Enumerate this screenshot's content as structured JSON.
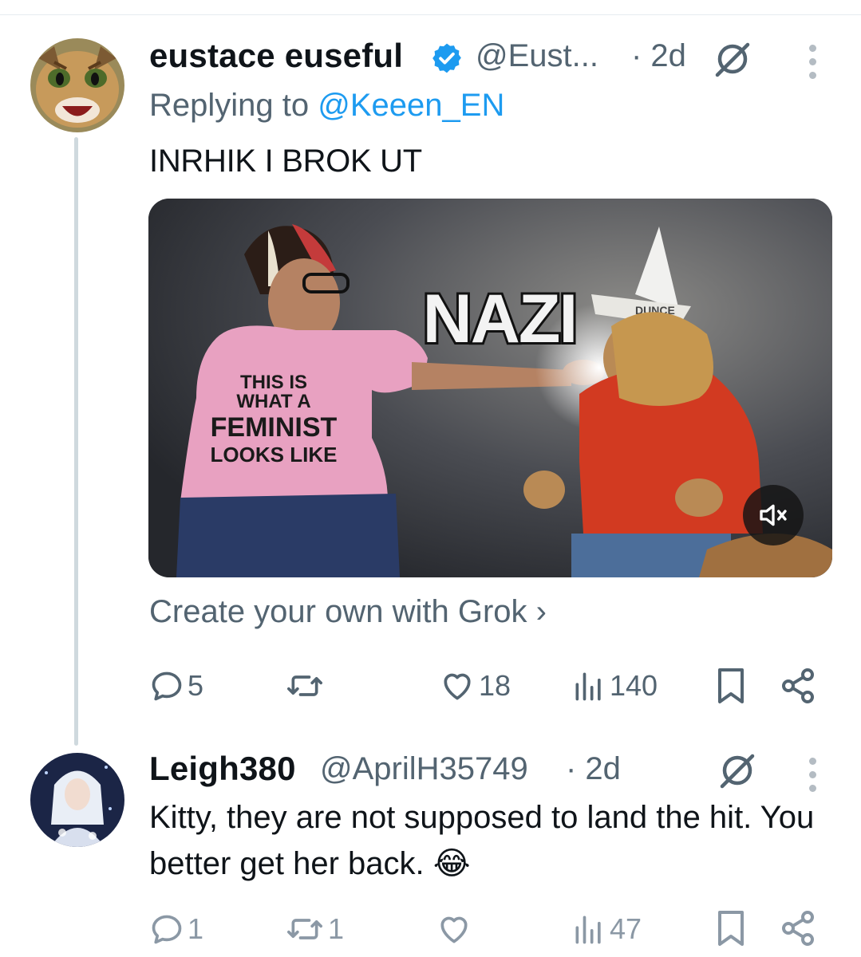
{
  "tweet1": {
    "display_name": "eustace euseful",
    "handle": "@Eust...",
    "time": "· 2d",
    "replying_prefix": "Replying to",
    "replying_handle": "@Keeen_EN",
    "text": "INRHIK I BROK UT",
    "media": {
      "overlay_word": "NAZI",
      "shirt_line1": "THIS IS",
      "shirt_line2": "WHAT A",
      "shirt_line3": "FEMINIST",
      "shirt_line4": "LOOKS LIKE",
      "hat_text": "DUNCE"
    },
    "grok_link": "Create your own with Grok ›",
    "stats": {
      "replies": "5",
      "reposts": "",
      "likes": "18",
      "views": "140"
    }
  },
  "tweet2": {
    "display_name": "Leigh380",
    "handle": "@AprilH35749",
    "time": "· 2d",
    "text": "Kitty, they are not supposed to land the hit. You better get her back. 😂",
    "stats": {
      "replies": "1",
      "reposts": "1",
      "likes": "",
      "views": "47"
    }
  },
  "icons": [
    "verified-badge-icon",
    "grok-icon",
    "more-icon",
    "reply-icon",
    "repost-icon",
    "like-icon",
    "views-icon",
    "bookmark-icon",
    "share-icon",
    "mute-icon"
  ],
  "colors": {
    "link": "#1d9bf0",
    "secondary": "#536471",
    "verified": "#1d9bf0",
    "divider": "#cfd9de"
  }
}
